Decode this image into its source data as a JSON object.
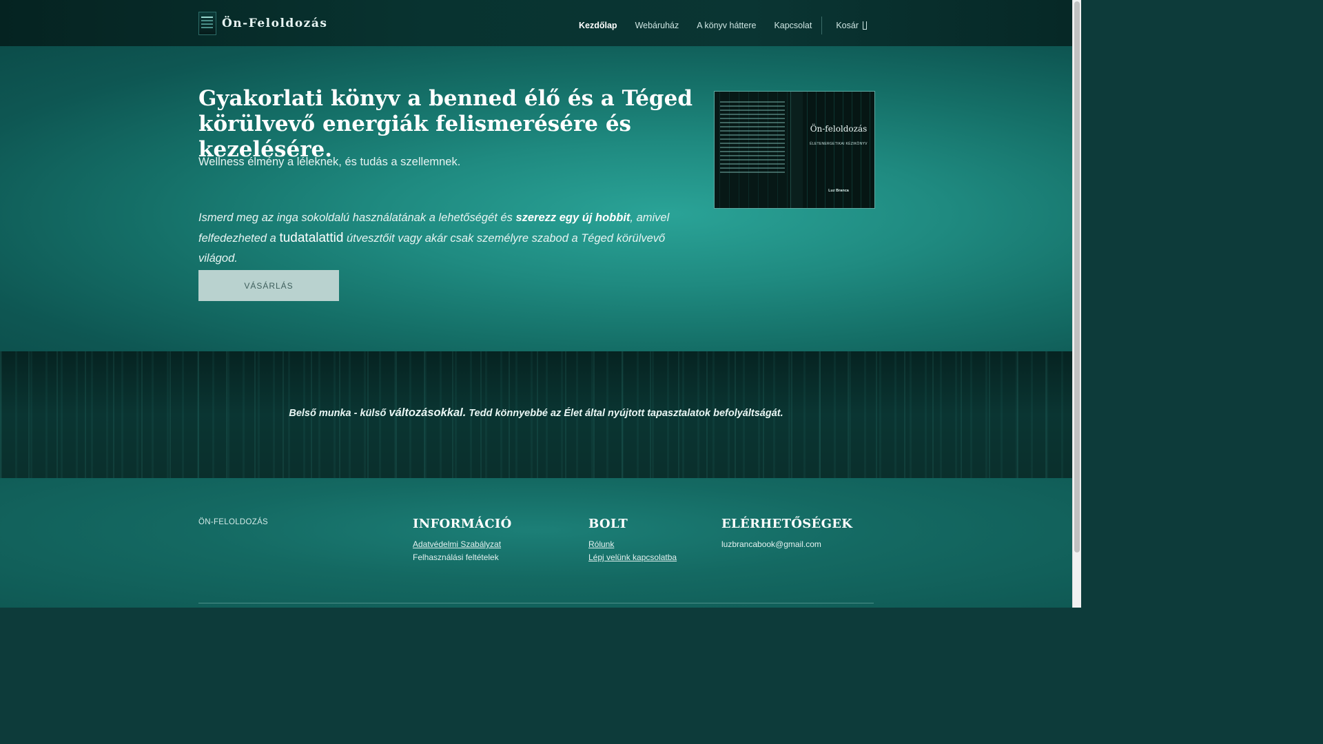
{
  "header": {
    "logo_text": "Ön-Feloldozás",
    "nav": [
      {
        "label": "Kezdőlap",
        "active": true
      },
      {
        "label": "Webáruház",
        "active": false
      },
      {
        "label": "A könyv háttere",
        "active": false
      },
      {
        "label": "Kapcsolat",
        "active": false
      }
    ],
    "cart_label": "Kosár",
    "cart_icon": "shopping-bag-icon"
  },
  "hero": {
    "title": "Gyakorlati könyv a benned élő és a Téged körülvevő energiák felismerésére és kezelésére.",
    "subtitle": "Wellness élmény a léleknek, és tudás a szellemnek.",
    "desc_part1": "Ismerd meg az inga sokoldalú használatának a lehetőségét és ",
    "desc_bold": "szerezz egy új hobbit",
    "desc_part2": ", amivel felfedezheted a ",
    "desc_big": "tudatalattid",
    "desc_part3": " útvesztőit vagy akár csak személyre szabod a Téged körülvevő világod.",
    "buy_button": "VÁSÁRLÁS"
  },
  "book_cover": {
    "title": "Ön-feloldozás",
    "subtitle": "ÉLETENERGETIKAI KÉZIKÖNYV",
    "author": "Luz Branca"
  },
  "quote": {
    "part1": "Belső munka - külső ",
    "big": "változásokkal.",
    "part2": " Tedd könnyebbé az Élet által nyújtott tapasztalatok befolyáltságát."
  },
  "footer": {
    "brand": "ÖN-FELOLDOZÁS",
    "info": {
      "heading": "INFORMÁCIÓ",
      "links": [
        "Adatvédelmi Szabályzat",
        "Felhasználási feltételek"
      ]
    },
    "shop": {
      "heading": "BOLT",
      "links": [
        "Rólunk",
        "Lépj velünk kapcsolatba"
      ]
    },
    "contact": {
      "heading": "ELÉRHETŐSÉGEK",
      "email": "luzbrancabook@gmail.com"
    }
  },
  "colors": {
    "accent": "#1f8a80",
    "button_bg": "#b9d2cf",
    "dark_band": "#0a3532"
  }
}
